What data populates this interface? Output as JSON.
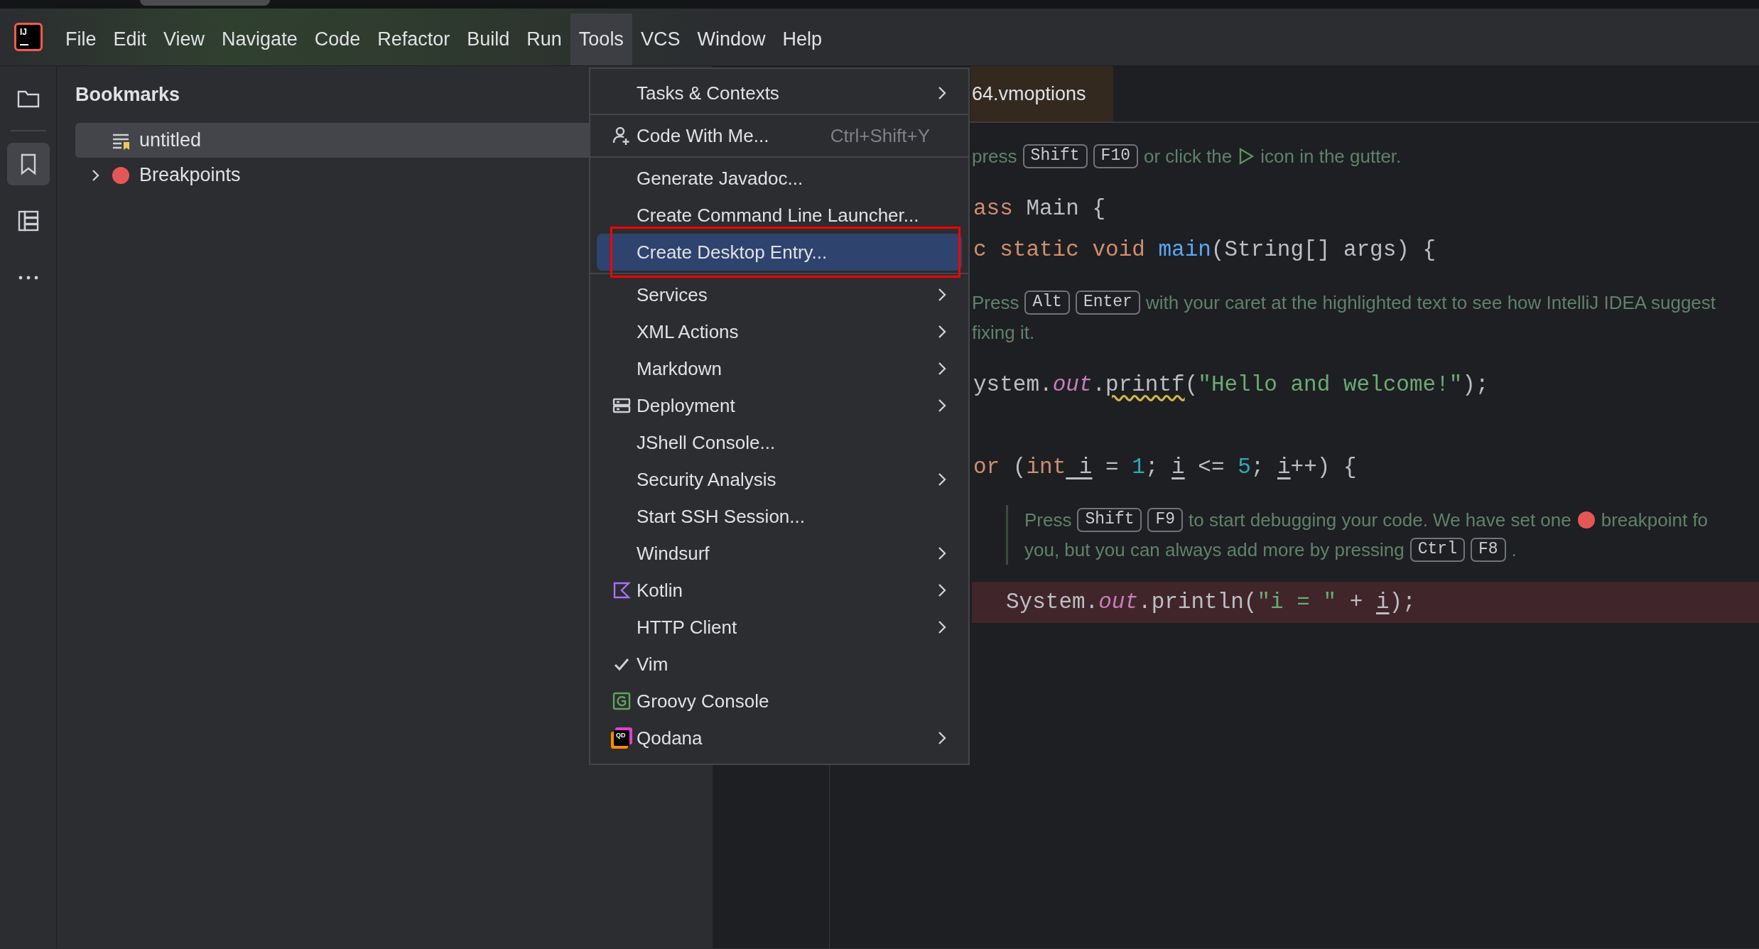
{
  "logo": {
    "text": "IJ"
  },
  "menubar": {
    "items": [
      {
        "label": "File",
        "selected": false
      },
      {
        "label": "Edit",
        "selected": false
      },
      {
        "label": "View",
        "selected": false
      },
      {
        "label": "Navigate",
        "selected": false
      },
      {
        "label": "Code",
        "selected": false
      },
      {
        "label": "Refactor",
        "selected": false
      },
      {
        "label": "Build",
        "selected": false
      },
      {
        "label": "Run",
        "selected": false
      },
      {
        "label": "Tools",
        "selected": true
      },
      {
        "label": "VCS",
        "selected": false
      },
      {
        "label": "Window",
        "selected": false
      },
      {
        "label": "Help",
        "selected": false
      }
    ]
  },
  "toolstrip": {
    "items": [
      {
        "kind": "folder",
        "selected": false
      },
      {
        "kind": "bookmark",
        "selected": true
      },
      {
        "kind": "structure",
        "selected": false
      },
      {
        "kind": "more",
        "selected": false
      }
    ]
  },
  "bookmarks_panel": {
    "title": "Bookmarks",
    "items": [
      {
        "label": "untitled",
        "kind": "bookmark-list",
        "selected": true,
        "expandable": false
      },
      {
        "label": "Breakpoints",
        "kind": "breakpoints",
        "selected": false,
        "expandable": true
      }
    ]
  },
  "editor": {
    "tabs": [
      {
        "title": "64.vmoptions",
        "selected": true
      }
    ],
    "lines": [
      {
        "kind": "hint",
        "nested": false,
        "rows": [
          {
            "parts": [
              {
                "kind": "text",
                "text": "press"
              },
              {
                "kind": "key",
                "text": "Shift"
              },
              {
                "kind": "key",
                "text": "F10"
              },
              {
                "kind": "text",
                "text": "or click the"
              },
              {
                "kind": "run-icon"
              },
              {
                "kind": "text",
                "text": "icon in the gutter."
              }
            ]
          }
        ]
      },
      {
        "kind": "code",
        "nested": false,
        "breakpoint": false,
        "tokens": [
          {
            "kind": "keyword",
            "text": "ass"
          },
          {
            "kind": "plain",
            "text": " Main {"
          }
        ]
      },
      {
        "kind": "code",
        "nested": false,
        "breakpoint": false,
        "tokens": [
          {
            "kind": "keyword",
            "text": "c static void"
          },
          {
            "kind": "function",
            "text": " main"
          },
          {
            "kind": "plain",
            "text": "(String[] args) {"
          }
        ]
      },
      {
        "kind": "hint",
        "nested": false,
        "rows": [
          {
            "parts": [
              {
                "kind": "text",
                "text": "Press"
              },
              {
                "kind": "key",
                "text": "Alt"
              },
              {
                "kind": "key",
                "text": "Enter"
              },
              {
                "kind": "text",
                "text": "with your caret at the highlighted text to see how IntelliJ IDEA suggest"
              }
            ]
          },
          {
            "parts": [
              {
                "kind": "text",
                "text": "fixing it."
              }
            ]
          }
        ]
      },
      {
        "kind": "code",
        "nested": false,
        "breakpoint": false,
        "tokens": [
          {
            "kind": "plain",
            "text": "ystem."
          },
          {
            "kind": "field",
            "text": "out"
          },
          {
            "kind": "plain",
            "text": "."
          },
          {
            "kind": "warning",
            "text": "printf"
          },
          {
            "kind": "plain",
            "text": "("
          },
          {
            "kind": "string",
            "text": "\"Hello and welcome!\""
          },
          {
            "kind": "plain",
            "text": ");"
          }
        ]
      },
      {
        "kind": "blank"
      },
      {
        "kind": "code",
        "nested": false,
        "breakpoint": false,
        "tokens": [
          {
            "kind": "keyword",
            "text": "or"
          },
          {
            "kind": "plain",
            "text": " ("
          },
          {
            "kind": "keyword",
            "text": "int"
          },
          {
            "kind": "variable",
            "text": " i"
          },
          {
            "kind": "plain",
            "text": " = "
          },
          {
            "kind": "number",
            "text": "1"
          },
          {
            "kind": "plain",
            "text": "; "
          },
          {
            "kind": "variable",
            "text": "i"
          },
          {
            "kind": "plain",
            "text": " <= "
          },
          {
            "kind": "number",
            "text": "5"
          },
          {
            "kind": "plain",
            "text": "; "
          },
          {
            "kind": "variable",
            "text": "i"
          },
          {
            "kind": "plain",
            "text": "++) {"
          }
        ]
      },
      {
        "kind": "hint",
        "nested": true,
        "rows": [
          {
            "parts": [
              {
                "kind": "text",
                "text": "Press"
              },
              {
                "kind": "key",
                "text": "Shift"
              },
              {
                "kind": "key",
                "text": "F9"
              },
              {
                "kind": "text",
                "text": "to start debugging your code. We have set one"
              },
              {
                "kind": "dot-icon"
              },
              {
                "kind": "text",
                "text": "breakpoint fo"
              }
            ]
          },
          {
            "parts": [
              {
                "kind": "text",
                "text": "you, but you can always add more by pressing"
              },
              {
                "kind": "key",
                "text": "Ctrl"
              },
              {
                "kind": "key",
                "text": "F8"
              },
              {
                "kind": "text",
                "text": "."
              }
            ]
          }
        ]
      },
      {
        "kind": "code",
        "nested": true,
        "breakpoint": true,
        "tokens": [
          {
            "kind": "plain",
            "text": "System."
          },
          {
            "kind": "field",
            "text": "out"
          },
          {
            "kind": "plain",
            "text": ".println("
          },
          {
            "kind": "string",
            "text": "\"i = \""
          },
          {
            "kind": "plain",
            "text": " + "
          },
          {
            "kind": "variable",
            "text": "i"
          },
          {
            "kind": "plain",
            "text": ");"
          }
        ]
      }
    ]
  },
  "tools_menu": {
    "groups": [
      {
        "items": [
          {
            "label": "Tasks & Contexts",
            "kind": "plain",
            "submenu": true,
            "selected": false,
            "marked": false
          }
        ]
      },
      {
        "items": [
          {
            "label": "Code With Me...",
            "kind": "person",
            "shortcut": "Ctrl+Shift+Y",
            "submenu": false,
            "selected": false,
            "marked": false
          }
        ]
      },
      {
        "items": [
          {
            "label": "Generate Javadoc...",
            "kind": "plain",
            "submenu": false,
            "selected": false,
            "marked": false
          },
          {
            "label": "Create Command Line Launcher...",
            "kind": "plain",
            "submenu": false,
            "selected": false,
            "marked": false
          },
          {
            "label": "Create Desktop Entry...",
            "kind": "plain",
            "submenu": false,
            "selected": true,
            "marked": true
          }
        ]
      },
      {
        "items": [
          {
            "label": "Services",
            "kind": "plain",
            "submenu": true,
            "selected": false,
            "marked": false
          },
          {
            "label": "XML Actions",
            "kind": "plain",
            "submenu": true,
            "selected": false,
            "marked": false
          },
          {
            "label": "Markdown",
            "kind": "plain",
            "submenu": true,
            "selected": false,
            "marked": false
          },
          {
            "label": "Deployment",
            "kind": "server",
            "submenu": true,
            "selected": false,
            "marked": false
          },
          {
            "label": "JShell Console...",
            "kind": "plain",
            "submenu": false,
            "selected": false,
            "marked": false
          },
          {
            "label": "Security Analysis",
            "kind": "plain",
            "submenu": true,
            "selected": false,
            "marked": false
          },
          {
            "label": "Start SSH Session...",
            "kind": "plain",
            "submenu": false,
            "selected": false,
            "marked": false
          },
          {
            "label": "Windsurf",
            "kind": "plain",
            "submenu": true,
            "selected": false,
            "marked": false
          },
          {
            "label": "Kotlin",
            "kind": "kotlin",
            "submenu": true,
            "selected": false,
            "marked": false
          },
          {
            "label": "HTTP Client",
            "kind": "plain",
            "submenu": true,
            "selected": false,
            "marked": false
          },
          {
            "label": "Vim",
            "kind": "toggle",
            "checked": true,
            "submenu": false,
            "selected": false,
            "marked": false
          },
          {
            "label": "Groovy Console",
            "kind": "groovy",
            "submenu": false,
            "selected": false,
            "marked": false
          },
          {
            "label": "Qodana",
            "kind": "qodana",
            "icon_text": "QD",
            "submenu": true,
            "selected": false,
            "marked": false
          }
        ]
      }
    ]
  }
}
